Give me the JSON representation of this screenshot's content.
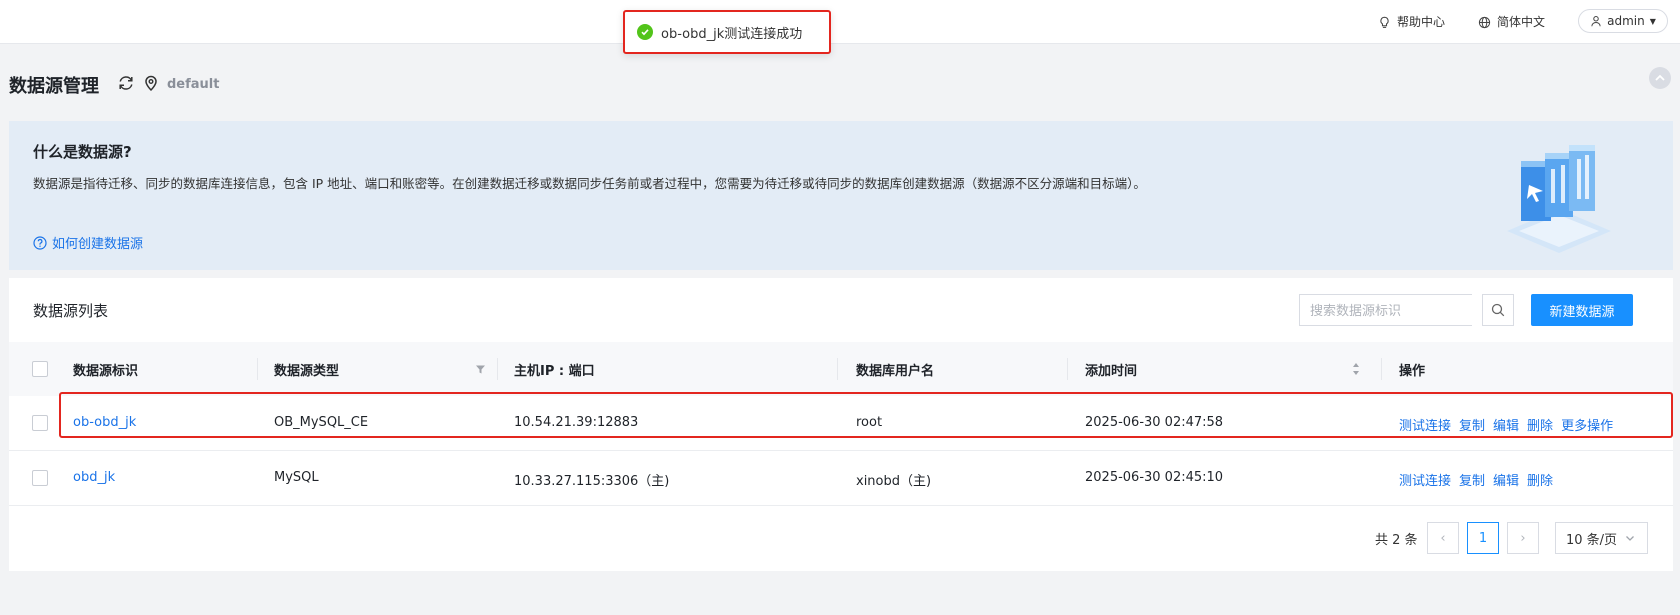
{
  "header": {
    "help_label": "帮助中心",
    "language_label": "简体中文",
    "user_label": "admin"
  },
  "toast": {
    "message": "ob-obd_jk测试连接成功",
    "status_color": "#52c41a"
  },
  "page": {
    "title": "数据源管理",
    "workspace": "default"
  },
  "banner": {
    "title": "什么是数据源?",
    "description": "数据源是指待迁移、同步的数据库连接信息，包含 IP 地址、端口和账密等。在创建数据迁移或数据同步任务前或者过程中，您需要为待迁移或待同步的数据库创建数据源（数据源不区分源端和目标端）。",
    "link_label": "如何创建数据源"
  },
  "list": {
    "title": "数据源列表",
    "search_placeholder": "搜索数据源标识",
    "new_button_label": "新建数据源",
    "columns": [
      "数据源标识",
      "数据源类型",
      "主机IP : 端口",
      "数据库用户名",
      "添加时间",
      "操作"
    ],
    "rows": [
      {
        "id": "ob-obd_jk",
        "type": "OB_MySQL_CE",
        "host": "10.54.21.39:12883",
        "user": "root",
        "added": "2025-06-30 02:47:58",
        "actions": [
          "测试连接",
          "复制",
          "编辑",
          "删除",
          "更多操作"
        ]
      },
      {
        "id": "obd_jk",
        "type": "MySQL",
        "host": "10.33.27.115:3306（主)",
        "user": "xinobd（主)",
        "added": "2025-06-30 02:45:10",
        "actions": [
          "测试连接",
          "复制",
          "编辑",
          "删除"
        ]
      }
    ]
  },
  "pagination": {
    "total_label": "共 2 条",
    "current_page": "1",
    "page_size": "10 条/页"
  },
  "colors": {
    "primary": "#1890ff",
    "link": "#1a73e8",
    "highlight_border": "#e3261f",
    "banner_bg": "#e3ecf6"
  }
}
